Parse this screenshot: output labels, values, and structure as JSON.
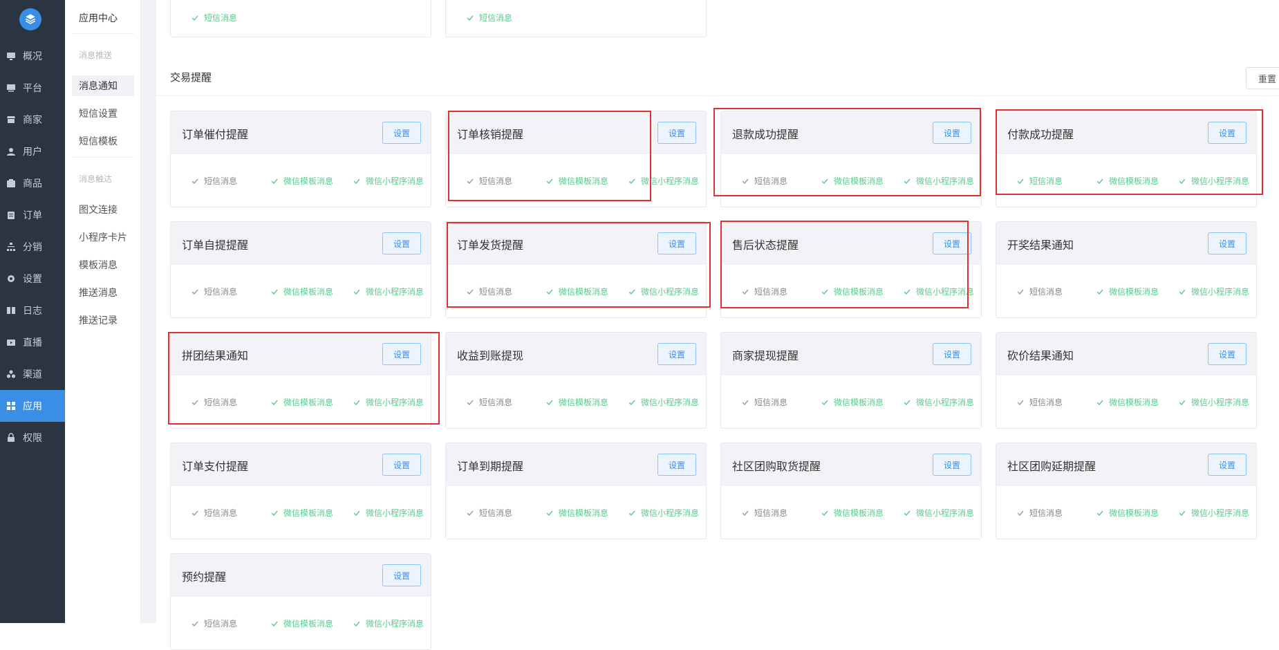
{
  "sidebar": {
    "items": [
      {
        "label": "概况",
        "icon": "monitor-icon"
      },
      {
        "label": "平台",
        "icon": "desktop-icon"
      },
      {
        "label": "商家",
        "icon": "store-icon"
      },
      {
        "label": "用户",
        "icon": "user-icon"
      },
      {
        "label": "商品",
        "icon": "goods-icon"
      },
      {
        "label": "订单",
        "icon": "clipboard-icon"
      },
      {
        "label": "分销",
        "icon": "sitemap-icon"
      },
      {
        "label": "设置",
        "icon": "gear-icon"
      },
      {
        "label": "日志",
        "icon": "book-icon"
      },
      {
        "label": "直播",
        "icon": "live-icon"
      },
      {
        "label": "渠道",
        "icon": "cluster-icon"
      },
      {
        "label": "应用",
        "icon": "grid-icon",
        "active": true
      },
      {
        "label": "权限",
        "icon": "lock-icon"
      }
    ]
  },
  "subnav": {
    "title": "应用中心",
    "group1": "消息推送",
    "group1_items": [
      "消息通知",
      "短信设置",
      "短信模板"
    ],
    "group2": "消息触达",
    "group2_items": [
      "图文连接",
      "小程序卡片",
      "模板消息",
      "推送消息",
      "推送记录"
    ]
  },
  "section": {
    "title": "交易提醒",
    "reset_label": "重置"
  },
  "labels": {
    "set_button": "设置",
    "sms": "短信消息",
    "wechat_template": "微信模板消息",
    "wechat_miniprogram": "微信小程序消息"
  },
  "top_row_tags": [
    "短信消息",
    "短信消息"
  ],
  "cards": [
    {
      "name": "订单催付提醒",
      "sms_on": false
    },
    {
      "name": "订单核销提醒",
      "sms_on": false
    },
    {
      "name": "退款成功提醒",
      "sms_on": false
    },
    {
      "name": "付款成功提醒",
      "sms_on": true
    },
    {
      "name": "订单自提提醒",
      "sms_on": false
    },
    {
      "name": "订单发货提醒",
      "sms_on": false
    },
    {
      "name": "售后状态提醒",
      "sms_on": false
    },
    {
      "name": "开奖结果通知",
      "sms_on": false
    },
    {
      "name": "拼团结果通知",
      "sms_on": false
    },
    {
      "name": "收益到账提现",
      "sms_on": false
    },
    {
      "name": "商家提现提醒",
      "sms_on": false
    },
    {
      "name": "砍价结果通知",
      "sms_on": false
    },
    {
      "name": "订单支付提醒",
      "sms_on": false
    },
    {
      "name": "订单到期提醒",
      "sms_on": false
    },
    {
      "name": "社区团购取货提醒",
      "sms_on": false
    },
    {
      "name": "社区团购延期提醒",
      "sms_on": false
    },
    {
      "name": "预约提醒",
      "sms_on": false
    }
  ],
  "colors": {
    "sidebar_bg": "#2b3542",
    "accent": "#3a8ee6",
    "success": "#5cc98b",
    "highlight": "#e03131"
  }
}
